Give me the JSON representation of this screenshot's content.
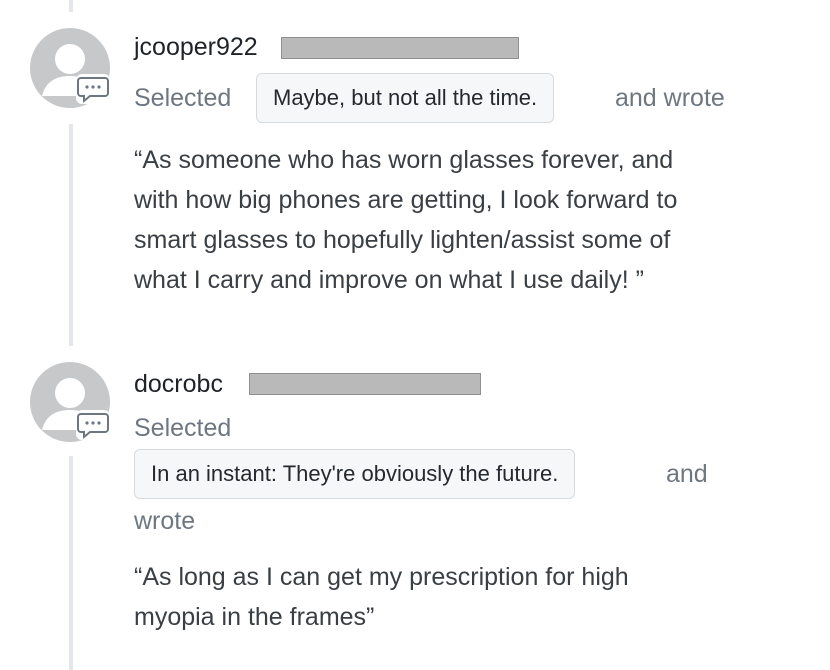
{
  "comments": [
    {
      "username": "jcooper922",
      "selected_label": "Selected",
      "choice": "Maybe, but not all the time.",
      "wrote_label": "and wrote",
      "quote_lines": [
        "“As someone who has worn glasses forever, and",
        "with how big phones are getting, I look forward to",
        "smart glasses to hopefully lighten/assist some of",
        "what I carry and improve on what I use daily! ”"
      ]
    },
    {
      "username": "docrobc",
      "selected_label": "Selected",
      "choice": "In an instant: They're obviously the future.",
      "and_label": "and",
      "wrote_label": "wrote",
      "quote_lines": [
        "“As long as I can get my prescription for high",
        "myopia in the frames”"
      ]
    }
  ],
  "icons": {
    "avatar": "default-user-avatar-icon",
    "badge": "comment-bubble-icon"
  },
  "colors": {
    "avatar_gray": "#c6c8ca",
    "badge_border": "#6e7781",
    "timeline": "#e4e6e9",
    "redaction": "#b9b9b9"
  }
}
